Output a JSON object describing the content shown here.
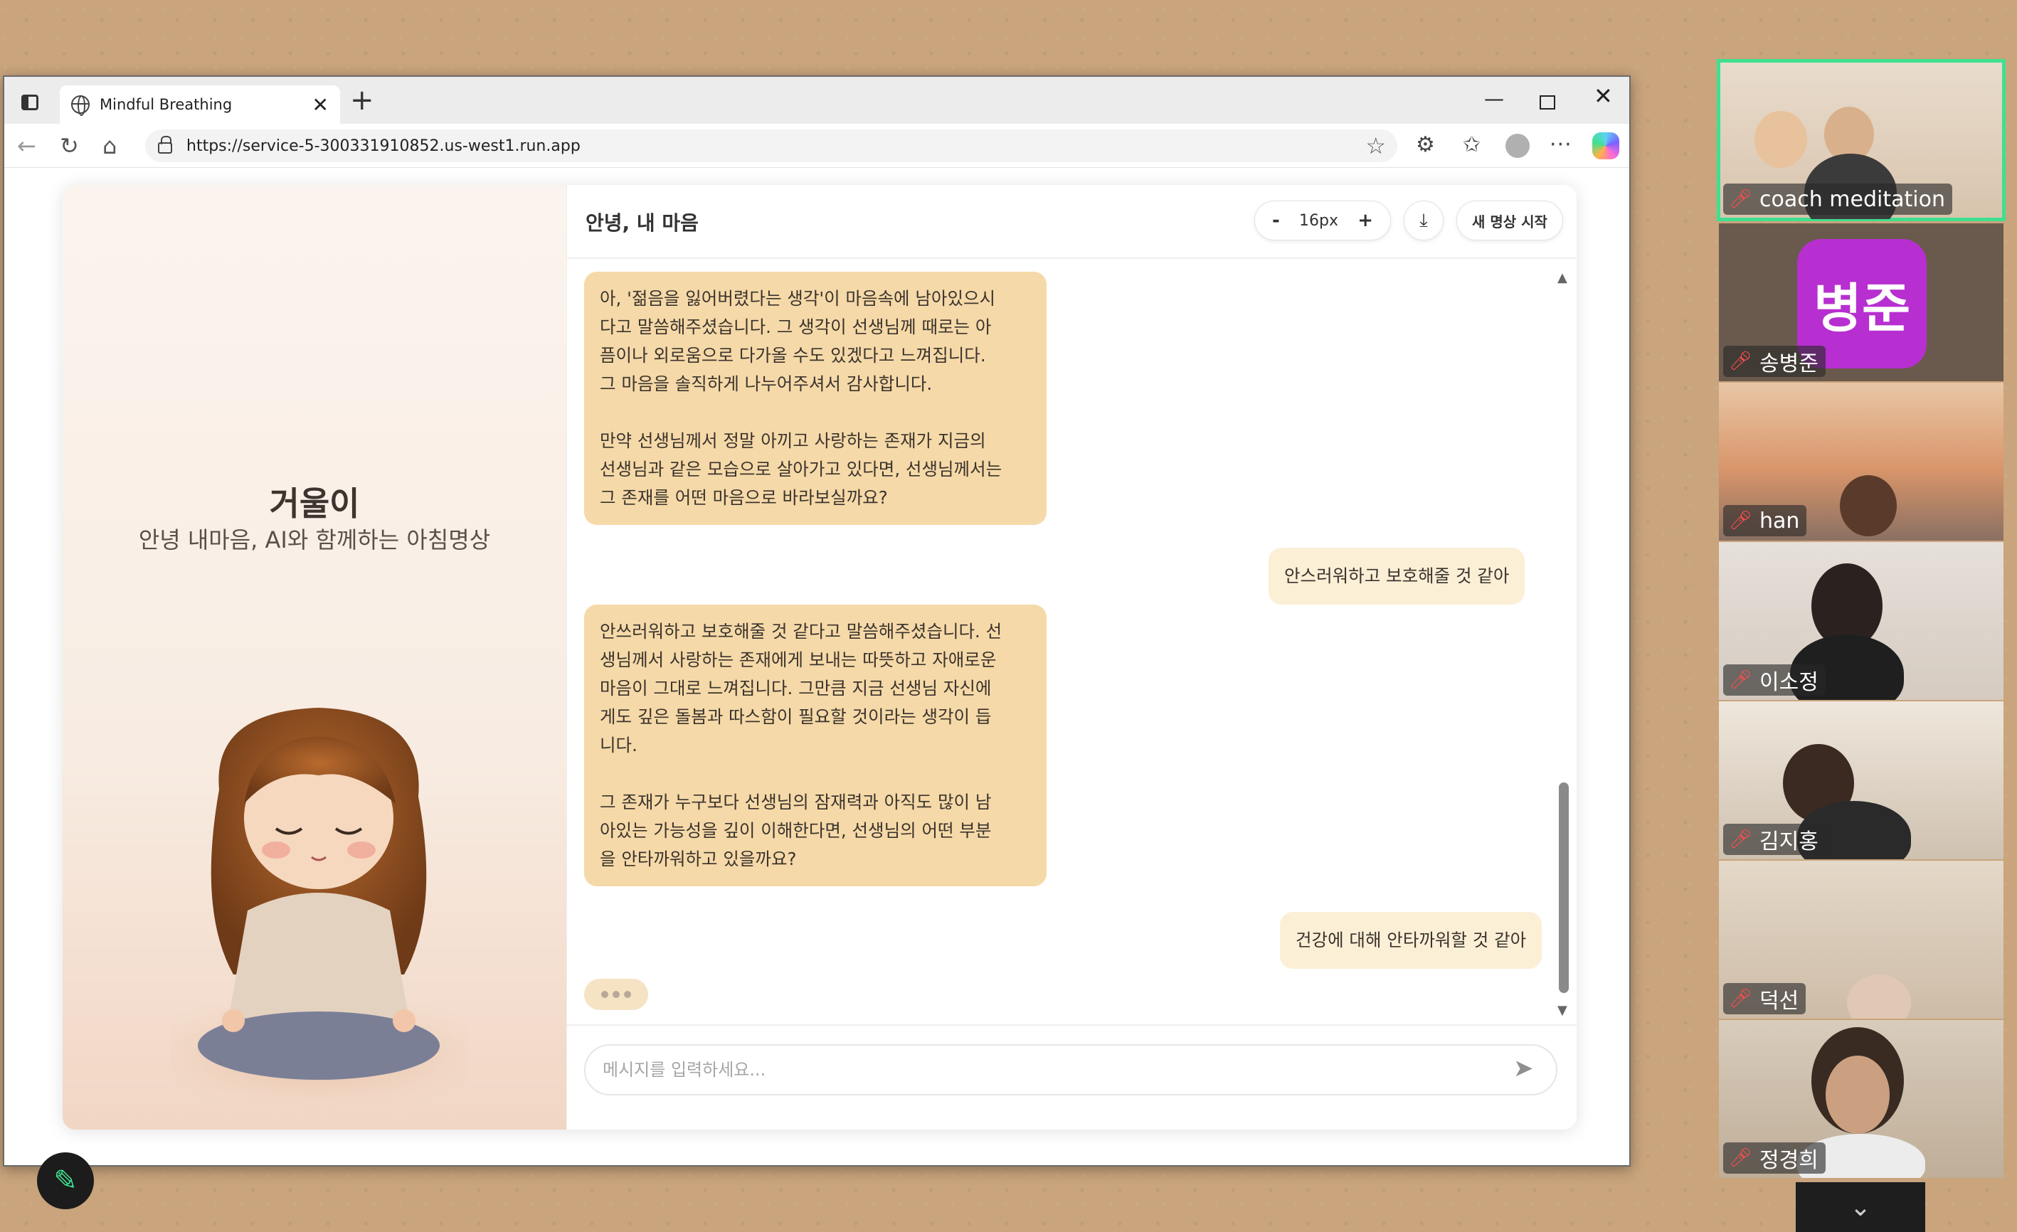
{
  "browser": {
    "tab_title": "Mindful Breathing",
    "url": "https://service-5-300331910852.us-west1.run.app"
  },
  "app": {
    "left_title": "거울이",
    "left_subtitle": "안녕 내마음, AI와 함께하는 아침명상",
    "chat_title": "안녕, 내 마음",
    "font_size_label": "16px",
    "font_decrease": "-",
    "font_increase": "+",
    "new_session_label": "새 명상 시작",
    "input_placeholder": "메시지를 입력하세요...",
    "messages": [
      {
        "role": "bot",
        "text": "아, '젊음을 잃어버렸다는 생각'이 마음속에 남아있으시\n다고 말씀해주셨습니다. 그 생각이 선생님께 때로는 아\n픔이나 외로움으로 다가올 수도 있겠다고 느껴집니다.\n그 마음을 솔직하게 나누어주셔서 감사합니다.\n\n만약 선생님께서 정말 아끼고 사랑하는 존재가 지금의\n선생님과 같은 모습으로 살아가고 있다면, 선생님께서는\n그 존재를 어떤 마음으로 바라보실까요?"
      },
      {
        "role": "user",
        "text": "안스러워하고 보호해줄 것 같아"
      },
      {
        "role": "bot",
        "text": "안쓰러워하고 보호해줄 것 같다고 말씀해주셨습니다. 선\n생님께서 사랑하는 존재에게 보내는 따뜻하고 자애로운\n마음이 그대로 느껴집니다. 그만큼 지금 선생님 자신에\n게도 깊은 돌봄과 따스함이 필요할 것이라는 생각이 듭\n니다.\n\n그 존재가 누구보다 선생님의 잠재력과 아직도 많이 남\n아있는 가능성을 깊이 이해한다면, 선생님의 어떤 부분\n을 안타까워하고 있을까요?"
      },
      {
        "role": "user",
        "text": "건강에 대해 안타까워할 것 같아"
      }
    ]
  },
  "participants": [
    {
      "name": "coach meditation",
      "active": true
    },
    {
      "name": "송병준",
      "avatar_text": "병준",
      "avatar_color": "#b72fd0"
    },
    {
      "name": "han"
    },
    {
      "name": "이소정"
    },
    {
      "name": "김지홍"
    },
    {
      "name": "덕선"
    },
    {
      "name": "정경희"
    }
  ],
  "colors": {
    "bot_bubble": "#f5d9a8",
    "user_bubble": "#fbefd6",
    "active_speaker": "#3ee08f"
  }
}
